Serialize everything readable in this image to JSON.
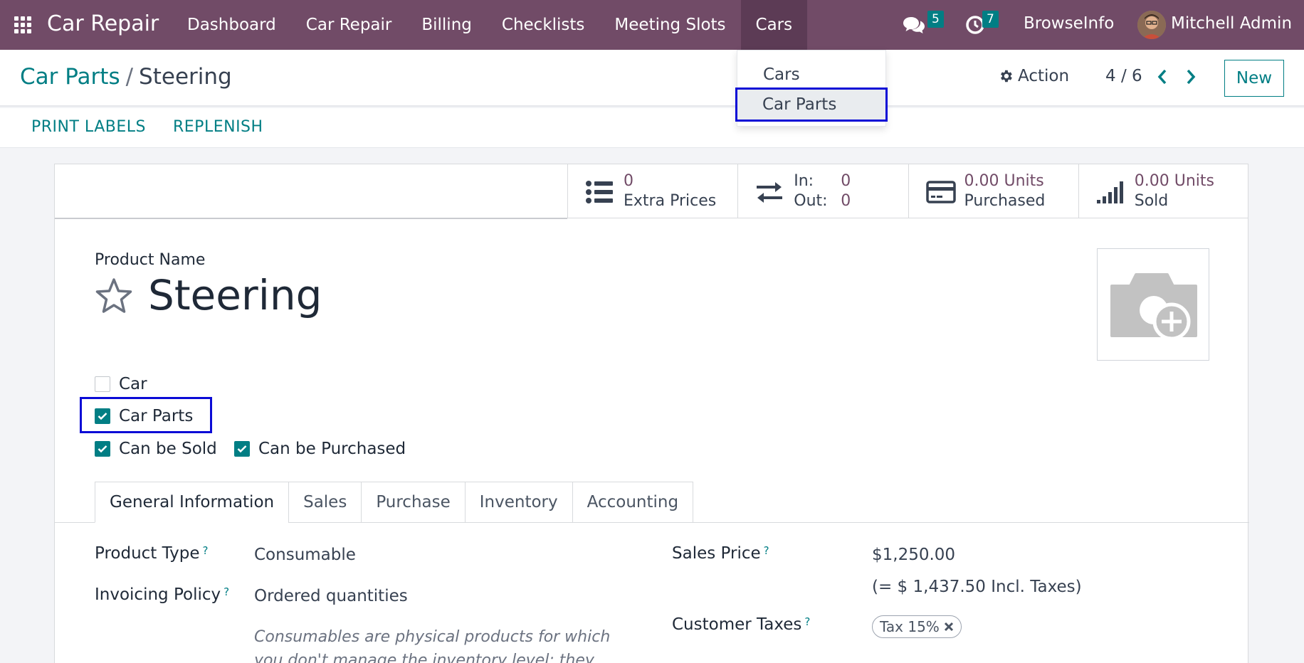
{
  "navbar": {
    "brand": "Car Repair",
    "menu": [
      "Dashboard",
      "Car Repair",
      "Billing",
      "Checklists",
      "Meeting Slots",
      "Cars"
    ],
    "messages_count": "5",
    "activities_count": "7",
    "company": "BrowseInfo",
    "user": "Mitchell Admin"
  },
  "dropdown": {
    "items": [
      "Cars",
      "Car Parts"
    ]
  },
  "breadcrumb": {
    "parent": "Car Parts",
    "separator": "/",
    "current": "Steering"
  },
  "control": {
    "action_label": "Action",
    "pager": "4 / 6",
    "new_label": "New"
  },
  "toolbar": {
    "print_labels": "PRINT LABELS",
    "replenish": "REPLENISH"
  },
  "stats": {
    "extra_prices_value": "0",
    "extra_prices_label": "Extra Prices",
    "in_label": "In:",
    "in_value": "0",
    "out_label": "Out:",
    "out_value": "0",
    "purchased_value": "0.00 Units",
    "purchased_label": "Purchased",
    "sold_value": "0.00 Units",
    "sold_label": "Sold"
  },
  "product": {
    "name_label": "Product Name",
    "name": "Steering"
  },
  "checkboxes": {
    "car": {
      "label": "Car",
      "checked": false
    },
    "car_parts": {
      "label": "Car Parts",
      "checked": true
    },
    "can_be_sold": {
      "label": "Can be Sold",
      "checked": true
    },
    "can_be_purchased": {
      "label": "Can be Purchased",
      "checked": true
    }
  },
  "tabs": [
    "General Information",
    "Sales",
    "Purchase",
    "Inventory",
    "Accounting"
  ],
  "general": {
    "product_type_label": "Product Type",
    "product_type": "Consumable",
    "invoicing_policy_label": "Invoicing Policy",
    "invoicing_policy": "Ordered quantities",
    "note": "Consumables are physical products for which you don't manage the inventory level: they",
    "sales_price_label": "Sales Price",
    "sales_price": "$1,250.00",
    "incl_taxes": "(= $ 1,437.50 Incl. Taxes)",
    "customer_taxes_label": "Customer Taxes",
    "tax_tag": "Tax 15%",
    "help_mark": "?"
  },
  "colors": {
    "navbar": "#714b67",
    "accent": "#017e84",
    "highlight": "#0b0bd6"
  }
}
